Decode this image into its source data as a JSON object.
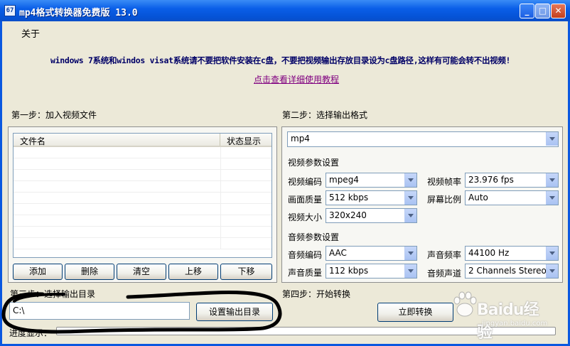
{
  "window": {
    "title": "mp4格式转换器免费版 13.0",
    "icon_text": "67"
  },
  "menu": {
    "about": "关于"
  },
  "notice": {
    "warning": "windows 7系统和windos visat系统请不要把软件安装在c盘，不要把视频输出存放目录设为c盘路径,这样有可能会转不出视频!",
    "tutorial_link": "点击查看详细使用教程"
  },
  "step1": {
    "label": "第一步：加入视频文件",
    "columns": [
      "文件名",
      "状态显示"
    ],
    "buttons": {
      "add": "添加",
      "delete": "删除",
      "clear": "清空",
      "up": "上移",
      "down": "下移"
    }
  },
  "step2": {
    "label": "第二步：选择输出格式",
    "format": "mp4",
    "video_section": "视频参数设置",
    "video": {
      "codec_label": "视频编码",
      "codec": "mpeg4",
      "framerate_label": "视频帧率",
      "framerate": "23.976 fps",
      "quality_label": "画面质量",
      "quality": "512 kbps",
      "aspect_label": "屏幕比例",
      "aspect": "Auto",
      "size_label": "视频大小",
      "size": "320x240"
    },
    "audio_section": "音频参数设置",
    "audio": {
      "codec_label": "音频编码",
      "codec": "AAC",
      "samplerate_label": "声音频率",
      "samplerate": "44100 Hz",
      "quality_label": "声音质量",
      "quality": "112 kbps",
      "channels_label": "音频声道",
      "channels": "2 Channels Stereo"
    }
  },
  "step3": {
    "label": "第三步：选择输出目录",
    "path": "C:\\",
    "button": "设置输出目录"
  },
  "step4": {
    "label": "第四步：开始转换",
    "button": "立即转换"
  },
  "progress": {
    "label": "进度显示：",
    "value": 0
  },
  "watermark": {
    "text": "Baidu经验",
    "sub": "jingyan.baidu.com"
  }
}
